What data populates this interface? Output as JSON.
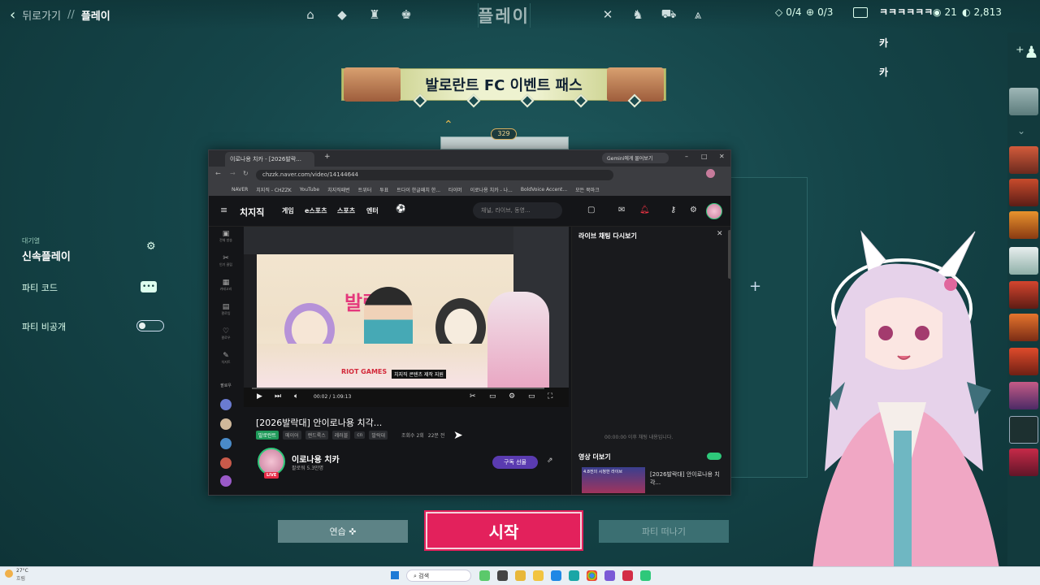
{
  "topbar": {
    "back_label": "뒤로가기",
    "separator": "//",
    "current": "플레이",
    "title": "플레이",
    "left_icons": [
      "home-icon",
      "career-icon",
      "battlepass-icon",
      "agents-icon"
    ],
    "right_icons": [
      "social-icon",
      "locker-icon",
      "store-icon",
      "rank-icon"
    ],
    "quest_progress": "0/4",
    "event_progress": "0/3",
    "kingdom_credits": "21",
    "valorant_points": "2,813"
  },
  "chat_overlay": {
    "name": "ㅋㅋㅋㅋㅋㅋ",
    "messages": [
      "카",
      "카"
    ]
  },
  "banner": {
    "title": "발로란트 FC 이벤트 패스"
  },
  "rank": {
    "badge": "329"
  },
  "left_panel": {
    "queue_label": "대기열",
    "mode": "신속플레이",
    "party_code_label": "파티 코드",
    "party_private_label": "파티 비공개"
  },
  "buttons": {
    "practice": "연습",
    "start": "시작",
    "leave_party": "파티 떠나기"
  },
  "browser": {
    "tab_title": "이로나용 치카 - [2026발락...",
    "gemini_tab": "Gemini에게 물어보기",
    "url": "chzzk.naver.com/video/14144644",
    "bookmarks": [
      "NAVER",
      "치지직 - CHZZK",
      "YouTube",
      "치지직패번",
      "트위터",
      "투표",
      "트다이 한글패치 한...",
      "타이머",
      "이로나용 치카 - 나...",
      "BoldVoice Accent...",
      "모든 북마크"
    ],
    "site": {
      "logo": "치지직",
      "nav": [
        "게임",
        "e스포츠",
        "스포츠",
        "엔터"
      ],
      "search_placeholder": "채널, 라이브, 동영...",
      "side_nav": [
        "전체 방송",
        "인기 클립",
        "카테고리",
        "팔로잉",
        "팔로우",
        "치지트"
      ],
      "side_follow_label": "팔로우"
    },
    "video": {
      "overlay_title": "발락대",
      "sponsor": "RIOT GAMES",
      "sponsor_tag": "치지직 콘텐츠 제작 지원",
      "time": "00:02 / 1:09:13",
      "title": "[2026발락대] 안이로나용 치각...",
      "tags": [
        "발로란트",
        "메이어",
        "랜드룩스",
        "레러블",
        "cn",
        "발락대"
      ],
      "views": "조회수 2회",
      "age": "22분 전"
    },
    "channel": {
      "name": "이로나용 치카",
      "followers": "팔로워 5.3만명",
      "live": "LIVE",
      "subscribe": "구독 선물"
    },
    "chat": {
      "header": "라이브 채팅 다시보기",
      "empty": "00:00:00 이후 채팅 내용입니다.",
      "more": "영상 더보기",
      "thumb_caption": "4.8전의 시청한 라이브",
      "thumb_title": "[2026발락대] 안이로나용 치각..."
    }
  },
  "taskbar": {
    "weather_temp": "27°C",
    "weather_desc": "흐림",
    "search": "검색"
  },
  "colors": {
    "start": "#e3215c",
    "bg": "#154549",
    "accent": "#5a3bb0"
  }
}
